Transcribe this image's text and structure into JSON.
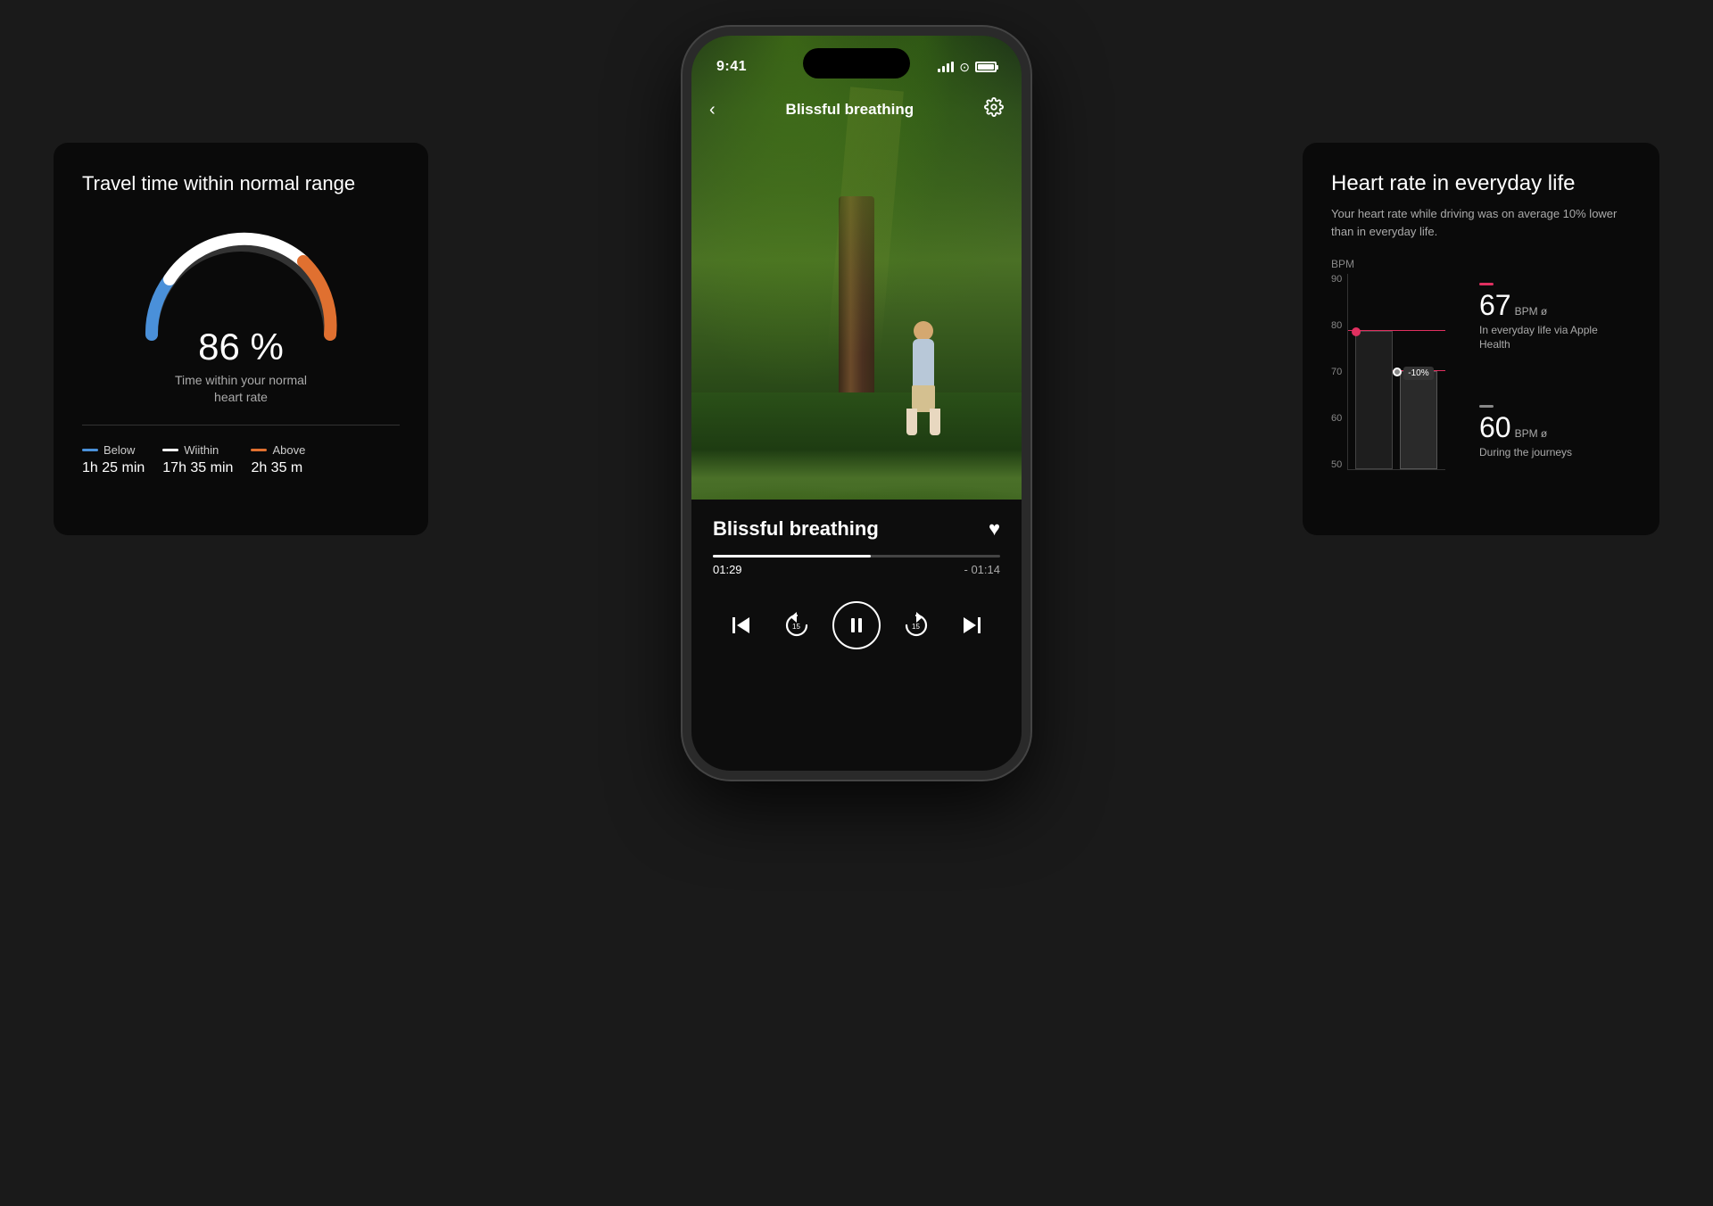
{
  "app": {
    "background_color": "#1a1a1a"
  },
  "left_panel": {
    "title": "Travel time within normal range",
    "gauge": {
      "percent": "86 %",
      "label": "Time within your normal\nheart rate"
    },
    "legend": [
      {
        "id": "below",
        "color": "blue",
        "name": "Below",
        "time": "1h 25 min"
      },
      {
        "id": "within",
        "color": "white",
        "name": "Wiithin",
        "time": "17h 35 min"
      },
      {
        "id": "above",
        "color": "orange",
        "name": "Above",
        "time": "2h 35 m"
      }
    ]
  },
  "right_panel": {
    "title": "Heart rate in everyday life",
    "subtitle": "Your heart rate while driving was on average 10% lower than in everyday life.",
    "chart": {
      "y_label": "BPM",
      "y_axis": [
        "90",
        "80",
        "70",
        "60",
        "50"
      ],
      "stats": [
        {
          "id": "everyday",
          "dash_color": "red",
          "bpm": "67",
          "unit": "BPM ø",
          "description": "In everyday life via Apple Health"
        },
        {
          "id": "journey",
          "dash_color": "grey",
          "bpm": "60",
          "unit": "BPM ø",
          "description": "During the journeys"
        }
      ],
      "percentage": "-10%"
    }
  },
  "phone": {
    "status_bar": {
      "time": "9:41"
    },
    "nav_bar": {
      "back_icon": "‹",
      "title": "Blissful breathing",
      "settings_icon": "⚙"
    },
    "content": {
      "title": "Blissful breathing",
      "heart_icon": "♥",
      "progress": {
        "fill_percent": 55,
        "current_time": "01:29",
        "remaining_time": "- 01:14"
      },
      "controls": {
        "skip_back_label": "|◁",
        "rewind_label": "↺15",
        "pause_label": "⏸",
        "forward_label": "↻15",
        "skip_forward_label": "▷|"
      }
    }
  }
}
